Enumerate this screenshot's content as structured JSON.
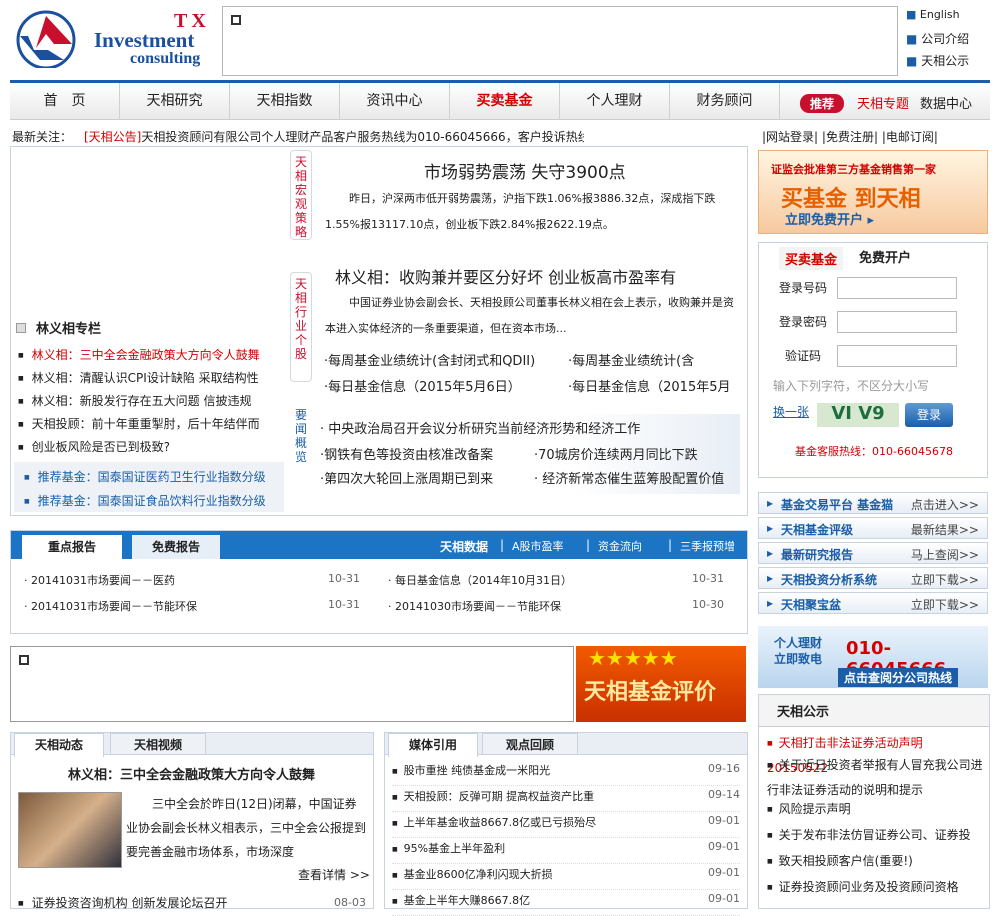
{
  "brand": {
    "tx": "TX",
    "line1": "Investment",
    "line2": "consulting"
  },
  "top_links": [
    "English",
    "公司介绍",
    "天相公示"
  ],
  "nav": [
    "首　页",
    "天相研究",
    "天相指数",
    "资讯中心",
    "买卖基金",
    "个人理财",
    "财务顾问"
  ],
  "nav_extra": {
    "badge": "推荐",
    "special": "天相专题",
    "data": "数据中心"
  },
  "ticker": {
    "label": "最新关注：",
    "tag": "[天相公告]",
    "text": "天相投资顾问有限公司个人理财产品客户服务热线为010-66045666，客户投诉热线"
  },
  "account_links": [
    "|网站登录|",
    "|免费注册|",
    "|电邮订阅|"
  ],
  "side_labels": [
    "天相宏观策略",
    "天相行业个股",
    "要闻概览"
  ],
  "column": {
    "title": "林义相专栏",
    "items": [
      "林义相：三中全会金融政策大方向令人鼓舞",
      "林义相：清醒认识CPI设计缺陷 采取结构性",
      "林义相：新股发行存在五大问题 信披违规",
      "天相投顾：前十年重重掣肘，后十年结伴而",
      "创业板风险是否已到极致?"
    ],
    "recommend": [
      "推荐基金：国泰国证医药卫生行业指数分级",
      "推荐基金：国泰国证食品饮料行业指数分级"
    ]
  },
  "headline1": {
    "title": "市场弱势震荡 失守3900点",
    "body": "昨日，沪深两市低开弱势震荡，沪指下跌1.06%报3886.32点，深成指下跌1.55%报13117.10点，创业板下跌2.84%报2622.19点。"
  },
  "headline2": {
    "title": "林义相：收购兼并要区分好坏 创业板高市盈率有",
    "body": "中国证券业协会副会长、天相投顾公司董事长林义相在会上表示，收购兼并是资本进入实体经济的一条重要渠道，但在资本市场..."
  },
  "briefs": [
    "·每周基金业绩统计(含封闭式和QDII)",
    "·每周基金业绩统计(含",
    "·每日基金信息（2015年5月6日）",
    "·每日基金信息（2015年5月"
  ],
  "news": [
    "· 中央政治局召开会议分析研究当前经济形势和经济工作",
    "·钢铁有色等投资由核准改备案",
    "·70城房价连续两月同比下跌",
    "·第四次大轮回上涨周期已到来",
    "· 经济新常态催生蓝筹股配置价值"
  ],
  "banner1": {
    "top": "证监会批准第三方基金销售第一家",
    "mid": "买基金 到天相",
    "bottom": "立即免费开户 ▸"
  },
  "login": {
    "tab1": "买卖基金",
    "tab2": "免费开户",
    "user": "登录号码",
    "pass": "登录密码",
    "code": "验证码",
    "hint": "输入下列字符，不区分大小写",
    "refresh": "换一张",
    "captcha": "VI V9",
    "submit": "登录",
    "hotline": "基金客服热线：010-66045678"
  },
  "services": [
    [
      "基金交易平台 基金猫",
      "点击进入>>"
    ],
    [
      "天相基金评级",
      "最新结果>>"
    ],
    [
      "最新研究报告",
      "马上查阅>>"
    ],
    [
      "天相投资分析系统",
      "立即下载>>"
    ],
    [
      "天相聚宝盆",
      "立即下载>>"
    ]
  ],
  "banner2": {
    "a": "个人理财",
    "b": "立即致电",
    "phone": "010-66045666",
    "foot": "点击查阅分公司热线"
  },
  "notice": {
    "title": "天相公示",
    "items": [
      "天相打击非法证券活动声明20150522",
      "关于近日投资者举报有人冒充我公司进行非法证券活动的说明和提示",
      "风险提示声明",
      "关于发布非法仿冒证券公司、证券投",
      "致天相投顾客户信(重要!)",
      "证券投资顾问业务及投资顾问资格"
    ]
  },
  "reports": {
    "tab1": "重点报告",
    "tab2": "免费报告",
    "links": [
      "天相数据",
      "A股市盈率",
      "资金流向",
      "三季报预增"
    ],
    "left": [
      [
        "20141031市场要闻－－医药",
        "10-31"
      ],
      [
        "20141031市场要闻－－节能环保",
        "10-31"
      ]
    ],
    "right": [
      [
        "每日基金信息（2014年10月31日）",
        "10-31"
      ],
      [
        "20141030市场要闻－－节能环保",
        "10-30"
      ]
    ]
  },
  "banner3": {
    "stars": "★★★★★",
    "text": "天相基金评价"
  },
  "dynamic": {
    "tab1": "天相动态",
    "tab2": "天相视频",
    "title": "林义相：三中全会金融政策大方向令人鼓舞",
    "body": "三中全会於昨日(12日)闭幕，中国证券业协会副会长林义相表示，三中全会公报提到要完善金融市场体系，市场深度",
    "more": "查看详情 >>",
    "last": [
      "证券投资咨询机构 创新发展论坛召开",
      "08-03"
    ]
  },
  "media": {
    "tab1": "媒体引用",
    "tab2": "观点回顾",
    "items": [
      [
        "股市重挫 纯债基金成一米阳光",
        "09-16"
      ],
      [
        "天相投顾：反弹可期 提高权益资产比重",
        "09-14"
      ],
      [
        "上半年基金收益8667.8亿或已亏损殆尽",
        "09-01"
      ],
      [
        "95%基金上半年盈利",
        "09-01"
      ],
      [
        "基金业8600亿净利闪现大折损",
        "09-01"
      ],
      [
        "基金上半年大赚8667.8亿",
        "09-01"
      ]
    ]
  }
}
